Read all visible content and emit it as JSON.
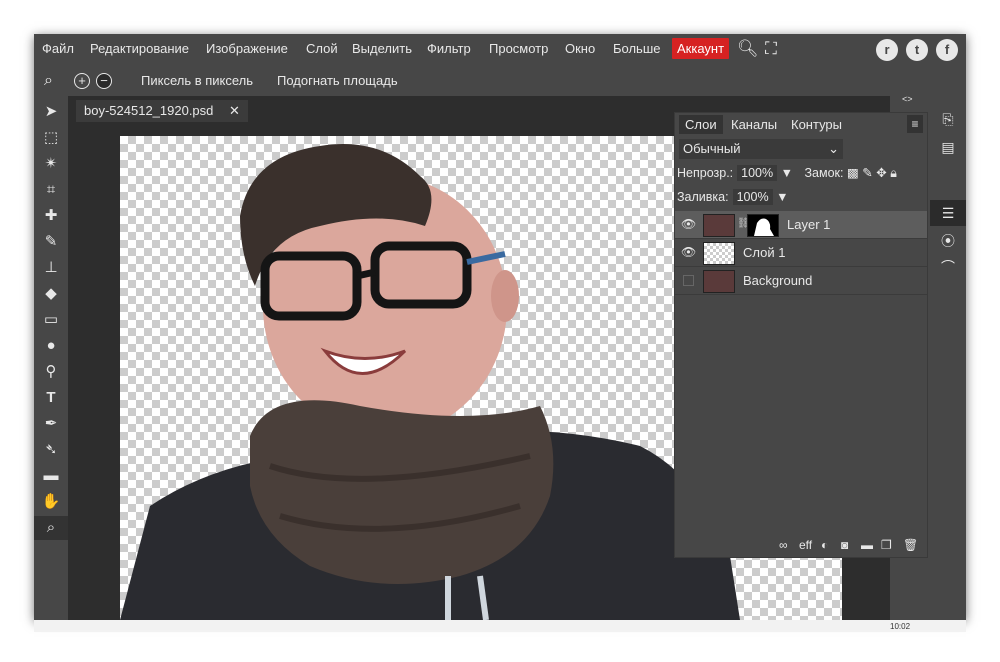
{
  "menubar": {
    "items": [
      "Файл",
      "Редактирование",
      "Изображение",
      "Слой",
      "Выделить",
      "Фильтр",
      "Просмотр",
      "Окно",
      "Больше"
    ],
    "account": "Аккаунт",
    "icons": [
      "search-icon",
      "fullscreen-icon"
    ],
    "social": [
      "reddit-icon",
      "twitter-icon",
      "facebook-icon"
    ]
  },
  "options": {
    "pixel_to_pixel": "Пиксель в пиксель",
    "fit_area": "Подогнать площадь"
  },
  "document": {
    "tab_name": "boy-524512_1920.psd",
    "close_glyph": "✕"
  },
  "layers_panel": {
    "tabs": [
      "Слои",
      "Каналы",
      "Контуры"
    ],
    "blend_mode": "Обычный",
    "opacity_label": "Непрозр.:",
    "opacity_value": "100%",
    "lock_label": "Замок:",
    "fill_label": "Заливка:",
    "fill_value": "100%",
    "layers": [
      {
        "name": "Layer 1",
        "visible": true,
        "selected": true,
        "has_mask": true
      },
      {
        "name": "Слой 1",
        "visible": true,
        "selected": false,
        "has_mask": false
      },
      {
        "name": "Background",
        "visible": false,
        "selected": false,
        "has_mask": false
      }
    ],
    "footer_icons": [
      "link-layers-icon",
      "effects-icon",
      "adjustment-icon",
      "mask-icon",
      "folder-icon",
      "new-layer-icon",
      "delete-icon"
    ],
    "footer_eff": "eff"
  },
  "colors": {
    "accent": "#d62222",
    "foreground": "#ffffff",
    "background": "#000000"
  },
  "status": {
    "clock": "10:02"
  }
}
